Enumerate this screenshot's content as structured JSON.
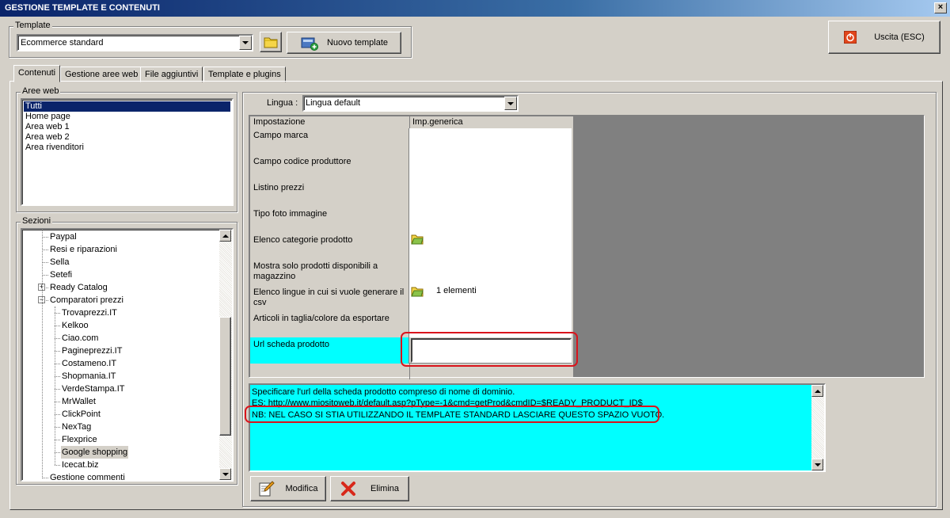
{
  "window": {
    "title": "GESTIONE TEMPLATE E CONTENUTI",
    "close_glyph": "×"
  },
  "template_group": {
    "legend": "Template",
    "selected": "Ecommerce standard",
    "new_button": "Nuovo template"
  },
  "exit_button": "Uscita (ESC)",
  "tabs": [
    {
      "label": "Contenuti",
      "active": true
    },
    {
      "label": "Gestione aree web",
      "active": false
    },
    {
      "label": "File aggiuntivi",
      "active": false
    },
    {
      "label": "Template e plugins",
      "active": false
    }
  ],
  "aree_web": {
    "legend": "Aree web",
    "items": [
      "Tutti",
      "Home page",
      "Area web 1",
      "Area web 2",
      "Area rivenditori"
    ],
    "selected_index": 0
  },
  "sezioni": {
    "legend": "Sezioni",
    "items": [
      {
        "label": "Paypal",
        "level": 1
      },
      {
        "label": "Resi e riparazioni",
        "level": 1
      },
      {
        "label": "Sella",
        "level": 1
      },
      {
        "label": "Setefi",
        "level": 1
      },
      {
        "label": "Ready Catalog",
        "level": 1,
        "expander": "+"
      },
      {
        "label": "Comparatori prezzi",
        "level": 1,
        "expander": "−"
      },
      {
        "label": "Trovaprezzi.IT",
        "level": 2
      },
      {
        "label": "Kelkoo",
        "level": 2
      },
      {
        "label": "Ciao.com",
        "level": 2
      },
      {
        "label": "Pagineprezzi.IT",
        "level": 2
      },
      {
        "label": "Costameno.IT",
        "level": 2
      },
      {
        "label": "Shopmania.IT",
        "level": 2
      },
      {
        "label": "VerdeStampa.IT",
        "level": 2
      },
      {
        "label": "MrWallet",
        "level": 2
      },
      {
        "label": "ClickPoint",
        "level": 2
      },
      {
        "label": "NexTag",
        "level": 2
      },
      {
        "label": "Flexprice",
        "level": 2
      },
      {
        "label": "Google shopping",
        "level": 2,
        "selected": true
      },
      {
        "label": "Icecat.biz",
        "level": 2
      },
      {
        "label": "Gestione commenti",
        "level": 1
      }
    ]
  },
  "lingua": {
    "label": "Lingua :",
    "selected": "Lingua default"
  },
  "grid": {
    "columns": [
      "Impostazione",
      "Imp.generica"
    ],
    "rows": [
      {
        "label": "Campo marca",
        "value": ""
      },
      {
        "label": "Campo codice produttore",
        "value": ""
      },
      {
        "label": "Listino prezzi",
        "value": ""
      },
      {
        "label": "Tipo foto immagine",
        "value": ""
      },
      {
        "label": "Elenco categorie prodotto",
        "value": "",
        "icon": "folder-icon"
      },
      {
        "label": "Mostra solo prodotti disponibili a magazzino",
        "value": ""
      },
      {
        "label": "Elenco lingue in cui si vuole generare il csv",
        "value": "1 elementi",
        "icon": "folder-icon"
      },
      {
        "label": "Articoli in taglia/colore da esportare",
        "value": ""
      },
      {
        "label": "Url scheda prodotto",
        "value": "",
        "selected": true,
        "editing": true
      }
    ]
  },
  "description": {
    "line1": "Specificare l'url della scheda prodotto compreso di nome di dominio.",
    "line2": "ES: http://www.miositoweb.it/default.asp?pType=-1&cmd=getProd&cmdID=$READY_PRODUCT_ID$",
    "line3": "NB: NEL CASO SI STIA UTILIZZANDO IL TEMPLATE STANDARD LASCIARE QUESTO SPAZIO VUOTO."
  },
  "actions": {
    "modify": "Modifica",
    "delete": "Elimina"
  },
  "colors": {
    "highlight": "#00ffff",
    "selection": "#0a246a",
    "annotation": "#d9141c"
  }
}
